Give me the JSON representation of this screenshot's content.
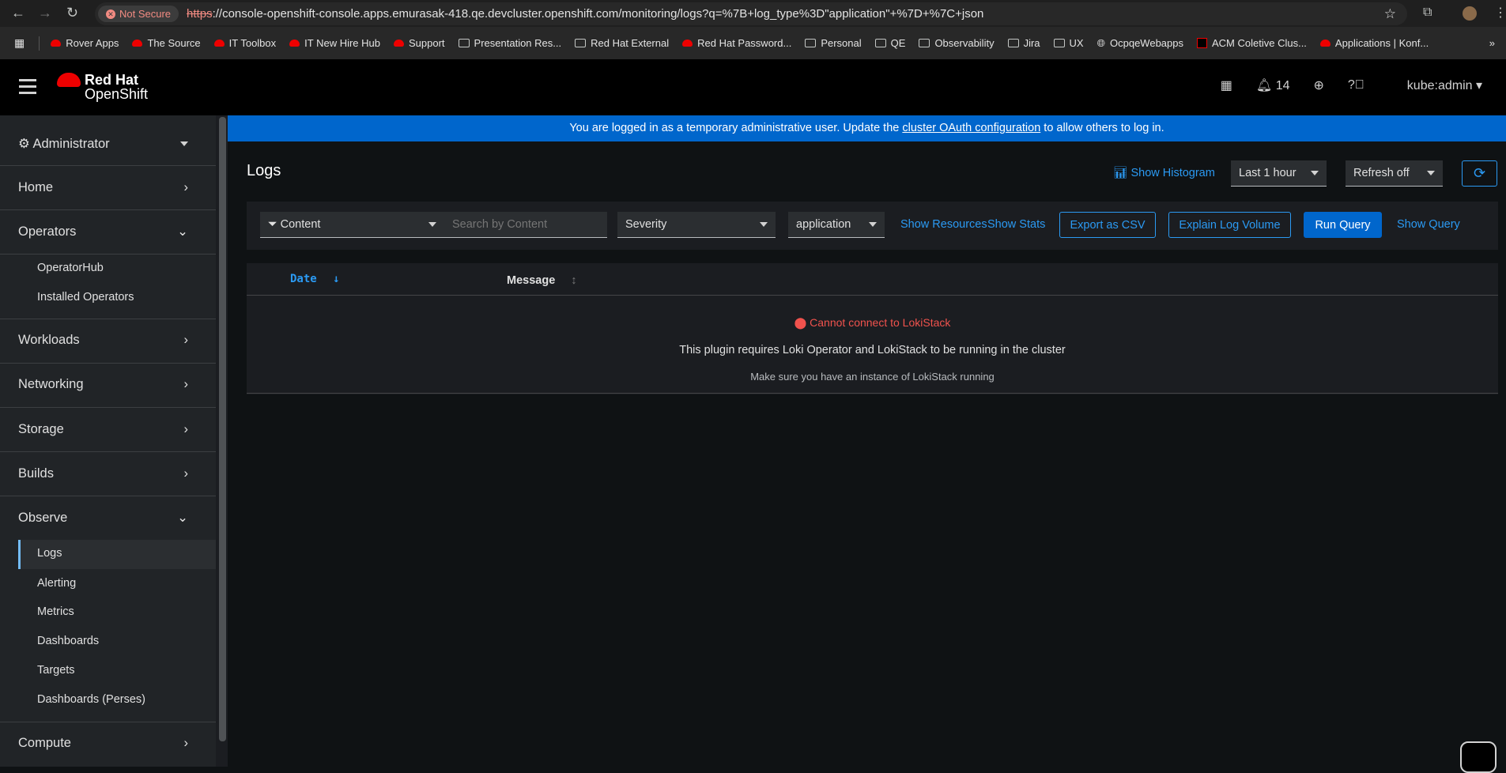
{
  "browser": {
    "not_secure": "Not Secure",
    "url_scheme": "https",
    "url_rest": "://console-openshift-console.apps.emurasak-418.qe.devcluster.openshift.com/monitoring/logs?q=%7B+log_type%3D\"application\"+%7D+%7C+json",
    "bookmarks": [
      {
        "label": "Rover Apps",
        "icon": "redhat"
      },
      {
        "label": "The Source",
        "icon": "redhat"
      },
      {
        "label": "IT Toolbox",
        "icon": "redhat"
      },
      {
        "label": "IT New Hire Hub",
        "icon": "redhat"
      },
      {
        "label": "Support",
        "icon": "redhat"
      },
      {
        "label": "Presentation Res...",
        "icon": "folder"
      },
      {
        "label": "Red Hat External",
        "icon": "folder"
      },
      {
        "label": "Red Hat Password...",
        "icon": "redhat"
      },
      {
        "label": "Personal",
        "icon": "folder"
      },
      {
        "label": "QE",
        "icon": "folder"
      },
      {
        "label": "Observability",
        "icon": "folder"
      },
      {
        "label": "Jira",
        "icon": "folder"
      },
      {
        "label": "UX",
        "icon": "folder"
      },
      {
        "label": "OcpqeWebapps",
        "icon": "globe"
      },
      {
        "label": "ACM Coletive Clus...",
        "icon": "app"
      },
      {
        "label": "Applications | Konf...",
        "icon": "redhat"
      }
    ]
  },
  "masthead": {
    "brand_line1": "Red Hat",
    "brand_line2": "OpenShift",
    "notifications": "14",
    "user": "kube:admin"
  },
  "sidebar": {
    "perspective": "Administrator",
    "items": [
      {
        "label": "Home"
      },
      {
        "label": "Operators",
        "sub": [
          "OperatorHub",
          "Installed Operators"
        ]
      },
      {
        "label": "Workloads"
      },
      {
        "label": "Networking"
      },
      {
        "label": "Storage"
      },
      {
        "label": "Builds"
      },
      {
        "label": "Observe",
        "sub": [
          "Logs",
          "Alerting",
          "Metrics",
          "Dashboards",
          "Targets",
          "Dashboards (Perses)"
        ]
      },
      {
        "label": "Compute"
      }
    ]
  },
  "banner": {
    "pre": "You are logged in as a temporary administrative user. Update the ",
    "link": "cluster OAuth configuration",
    "post": " to allow others to log in."
  },
  "page": {
    "title": "Logs",
    "show_histogram": "Show Histogram",
    "time_range": "Last 1 hour",
    "refresh": "Refresh off"
  },
  "toolbar": {
    "filter_attr": "Content",
    "search_placeholder": "Search by Content",
    "severity": "Severity",
    "tenant": "application",
    "show_resources": "Show Resources",
    "show_stats": "Show Stats",
    "export_csv": "Export as CSV",
    "explain": "Explain Log Volume",
    "run_query": "Run Query",
    "show_query": "Show Query"
  },
  "table": {
    "col_date": "Date",
    "col_message": "Message"
  },
  "empty": {
    "title": "Cannot connect to LokiStack",
    "body": "This plugin requires Loki Operator and LokiStack to be running in the cluster",
    "hint": "Make sure you have an instance of LokiStack running"
  },
  "colors": {
    "accent": "#0066cc",
    "link": "#2b9af3",
    "danger": "#f0524d"
  }
}
